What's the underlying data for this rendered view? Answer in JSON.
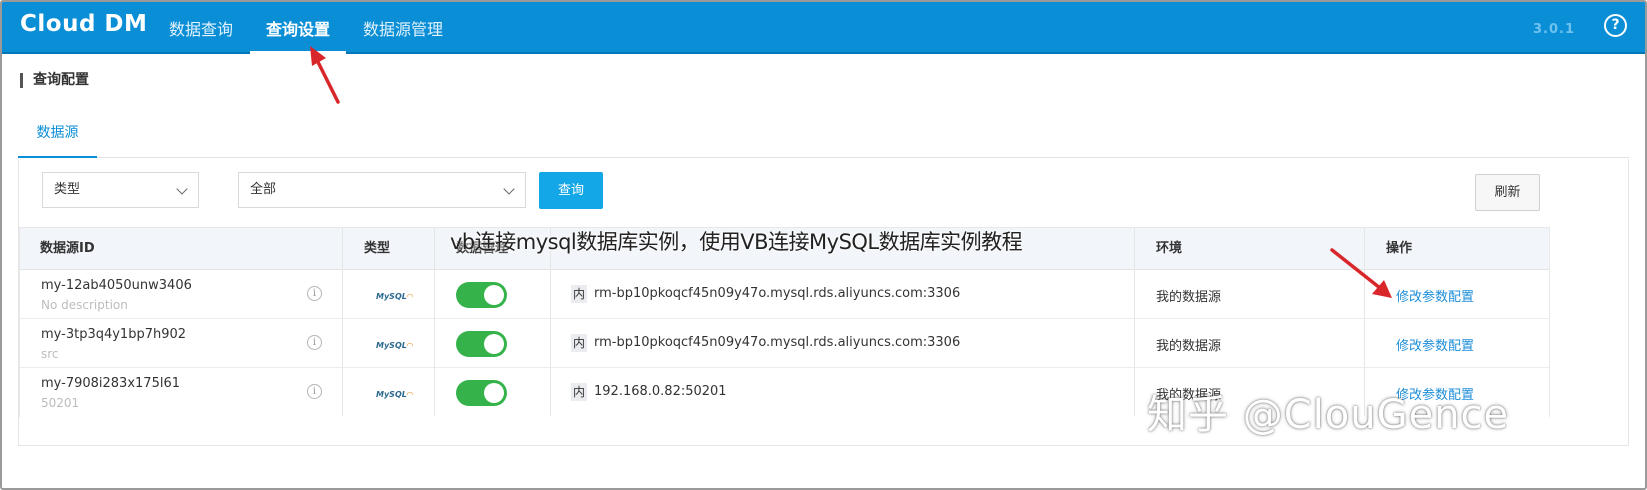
{
  "app": {
    "logo": "Cloud DM",
    "version": "3.0.1",
    "help_icon": "?"
  },
  "nav": {
    "items": [
      {
        "label": "数据查询",
        "active": false
      },
      {
        "label": "查询设置",
        "active": true
      },
      {
        "label": "数据源管理",
        "active": false
      }
    ]
  },
  "page": {
    "title": "查询配置",
    "tab": "数据源"
  },
  "filters": {
    "type_select": {
      "value": "类型"
    },
    "scope_select": {
      "value": "全部"
    },
    "query_button": "查询",
    "refresh_button": "刷新"
  },
  "table": {
    "headers": {
      "id": "数据源ID",
      "type": "类型",
      "manage": "数据管理",
      "env": "环境",
      "action": "操作"
    },
    "rows": [
      {
        "id": "my-12ab4050unw3406",
        "desc": "No description",
        "type_logo": "MySQL",
        "enabled": true,
        "addr_badge": "内",
        "address": "rm-bp10pkoqcf45n09y47o.mysql.rds.aliyuncs.com:3306",
        "env": "我的数据源",
        "action": "修改参数配置"
      },
      {
        "id": "my-3tp3q4y1bp7h902",
        "desc": "src",
        "type_logo": "MySQL",
        "enabled": true,
        "addr_badge": "内",
        "address": "rm-bp10pkoqcf45n09y47o.mysql.rds.aliyuncs.com:3306",
        "env": "我的数据源",
        "action": "修改参数配置"
      },
      {
        "id": "my-7908i283x175l61",
        "desc": "50201",
        "type_logo": "MySQL",
        "enabled": true,
        "addr_badge": "内",
        "address": "192.168.0.82:50201",
        "env": "我的数据源",
        "action": "修改参数配置"
      }
    ]
  },
  "overlay": {
    "caption": "vb连接mysql数据库实例，使用VB连接MySQL数据库实例教程",
    "watermark": "知乎 @ClouGence"
  },
  "colors": {
    "header_bg": "#0a8ed6",
    "primary_button": "#14a7e8",
    "toggle_on": "#35b34a",
    "link": "#1e8ed8",
    "annotation_arrow": "#d9262a"
  }
}
